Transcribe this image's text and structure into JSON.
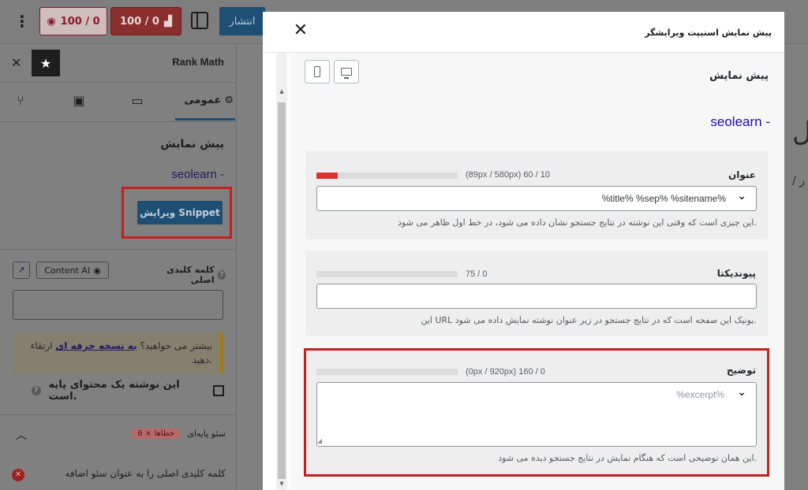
{
  "toolbar": {
    "more_icon": "⋮",
    "score_content": "100 / 0",
    "score_seo": "100 / 0",
    "publish_label": "انتشار"
  },
  "sidebar": {
    "title": "Rank Math",
    "close": "✕",
    "star": "★",
    "tab_general": "عمومی",
    "preview_label": "پیش نمایش",
    "site_line": "seolearn -",
    "edit_snippet_button": "ویرایش Snippet",
    "focus_keyword_label": "کلمه کلیدی اصلی",
    "content_ai_label": "Content AI",
    "notice_text_before": "بیشتر می خواهید؟",
    "notice_link": "به نسخه حرفه ای",
    "notice_text_after": "ارتقاء دهید.",
    "pillar_label": "این نوشته یک محتوای پایه است.",
    "basic_seo_label": "سئو پایه‌ای",
    "errors_badge": "6 × خطاها",
    "issue_text": "کلمه کلیدی اصلی را به عنوان سئو اضافه"
  },
  "modal": {
    "title": "پیش نمایش اسنیپت ویرایشگر",
    "close": "✕",
    "preview_heading": "پیش نمایش",
    "serp_site": "seolearn -",
    "title_field": {
      "label": "عنوان",
      "counter": "(89px / 580px) 60 / 10",
      "value": "%title% %sep% %sitename%",
      "progress": 0.15,
      "help": "این چیزی است که وقتی این نوشته در نتایج جستجو نشان داده می شود، در خط اول ظاهر می شود."
    },
    "permalink_field": {
      "label": "پیوندیکتا",
      "counter": "75 / 0",
      "value": "",
      "progress": 0,
      "help": "این URL یونیک این صفحه است که در نتایج جستجو در زیر عنوان نوشته نمایش داده می شود."
    },
    "description_field": {
      "label": "توضیح",
      "counter": "(0px / 920px) 160 / 0",
      "placeholder": "%excerpt%",
      "progress": 0,
      "help": "این همان توضیحی است که هنگام نمایش در نتایج جستجو دیده می شود."
    }
  },
  "colors": {
    "accent": "#1d4e74",
    "error": "#dc3232",
    "highlight_box": "#c81e1e",
    "serp_link": "#1a0dab"
  }
}
